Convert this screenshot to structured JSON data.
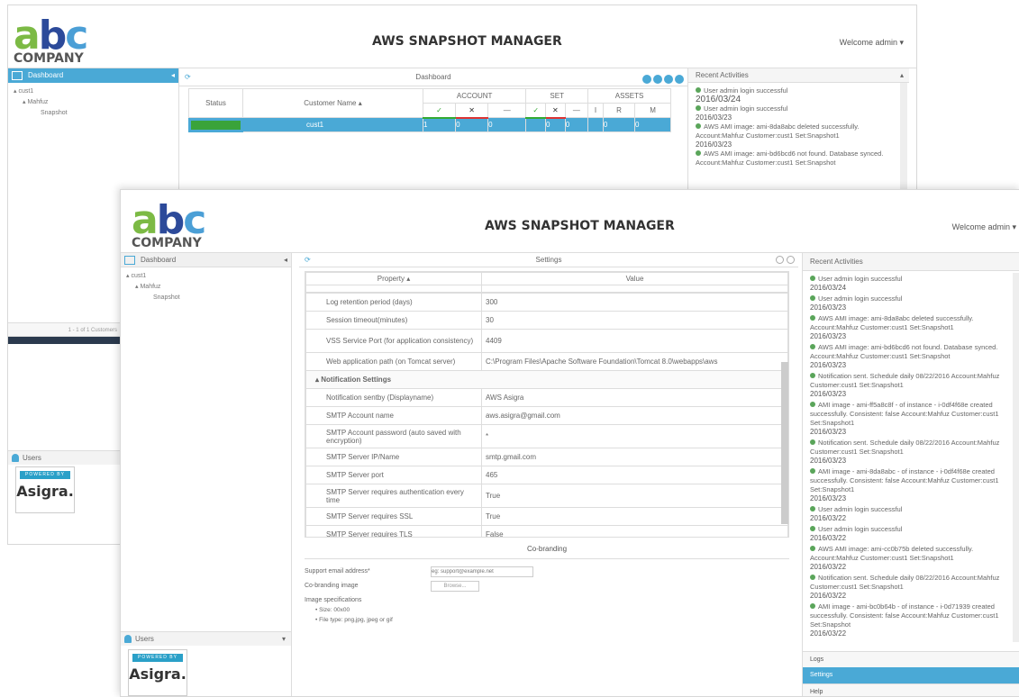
{
  "back": {
    "logo": {
      "a": "a",
      "b": "b",
      "c": "c",
      "company": "COMPANY"
    },
    "title": "AWS SNAPSHOT MANAGER",
    "welcome": "Welcome admin ▾",
    "tree_header": "Dashboard",
    "tree": [
      "cust1",
      "Mahfuz",
      "Snapshot"
    ],
    "center_title": "Dashboard",
    "table": {
      "status_col": "Status",
      "customer_col": "Customer Name ▴",
      "groups": [
        "ACCOUNT",
        "SET",
        "ASSETS"
      ],
      "sub": [
        "✓",
        "✕",
        "—",
        "✓",
        "✕",
        "—",
        "I",
        "R",
        "M"
      ],
      "row": {
        "customer": "cust1",
        "cells": [
          "1",
          "0",
          "0",
          "",
          "0",
          "0",
          "",
          "0",
          "0"
        ]
      }
    },
    "pager": "1 - 1 of 1 Customers",
    "recent_header": "Recent Activities",
    "activities": [
      {
        "text": "User admin login successful",
        "date": "2016/03/24"
      },
      {
        "text": "User admin login successful",
        "date": "2016/03/23"
      },
      {
        "text": "AWS AMI image: ami-8da8abc deleted successfully. Account:Mahfuz Customer:cust1 Set:Snapshot1",
        "date": "2016/03/23"
      },
      {
        "text": "AWS AMI image: ami-bd6bcd6 not found. Database synced. Account:Mahfuz Customer:cust1 Set:Snapshot",
        "date": ""
      }
    ],
    "users": "Users",
    "asigra": {
      "powered": "POWERED BY",
      "name": "Asigra."
    }
  },
  "front": {
    "logo": {
      "a": "a",
      "b": "b",
      "c": "c",
      "company": "COMPANY"
    },
    "title": "AWS SNAPSHOT MANAGER",
    "welcome": "Welcome admin ▾",
    "tree_header": "Dashboard",
    "tree": [
      "cust1",
      "Mahfuz",
      "Snapshot"
    ],
    "center_title": "Settings",
    "cols": {
      "property": "Property ▴",
      "value": "Value"
    },
    "rows": [
      {
        "p": "Log retention period (days)",
        "v": "300"
      },
      {
        "p": "Session timeout(minutes)",
        "v": "30"
      },
      {
        "p": "VSS Service Port (for application consistency)",
        "v": "4409"
      },
      {
        "p": "Web application path (on Tomcat server)",
        "v": "C:\\Program Files\\Apache Software Foundation\\Tomcat 8.0\\webapps\\aws"
      },
      {
        "p": "Notification Settings",
        "v": "",
        "group": true
      },
      {
        "p": "Notification sentby (Displayname)",
        "v": "AWS Asigra"
      },
      {
        "p": "SMTP Account name",
        "v": "aws.asigra@gmail.com"
      },
      {
        "p": "SMTP Account password (auto saved with encryption)",
        "v": "*"
      },
      {
        "p": "SMTP Server IP/Name",
        "v": "smtp.gmail.com"
      },
      {
        "p": "SMTP Server port",
        "v": "465"
      },
      {
        "p": "SMTP Server requires authentication every time",
        "v": "True"
      },
      {
        "p": "SMTP Server requires SSL",
        "v": "True"
      },
      {
        "p": "SMTP Server requires TLS",
        "v": "False"
      }
    ],
    "cobranding": {
      "header": "Co-branding",
      "email_label": "Support email address*",
      "email_placeholder": "eg: support@example.net",
      "image_label": "Co-branding image",
      "browse": "Browse...",
      "spec_label": "Image specifications",
      "specs": [
        "Size: 00x00",
        "File type: png,jpg, jpeg or gif"
      ]
    },
    "recent_header": "Recent Activities",
    "activities": [
      {
        "text": "User admin login successful",
        "date": "2016/03/24"
      },
      {
        "text": "User admin login successful",
        "date": "2016/03/23"
      },
      {
        "text": "AWS AMI image: ami-8da8abc deleted successfully. Account:Mahfuz Customer:cust1 Set:Snapshot1",
        "date": "2016/03/23"
      },
      {
        "text": "AWS AMI image: ami-bd6bcd6 not found. Database synced. Account:Mahfuz Customer:cust1 Set:Snapshot",
        "date": "2016/03/23"
      },
      {
        "text": "Notification sent. Schedule daily 08/22/2016 Account:Mahfuz Customer:cust1 Set:Snapshot1",
        "date": "2016/03/23"
      },
      {
        "text": "AMI image - ami-ff5a8c8f - of instance - i-0df4f68e created successfully. Consistent: false Account:Mahfuz Customer:cust1 Set:Snapshot1",
        "date": "2016/03/23"
      },
      {
        "text": "Notification sent. Schedule daily 08/22/2016 Account:Mahfuz Customer:cust1 Set:Snapshot1",
        "date": "2016/03/23"
      },
      {
        "text": "AMI image - ami-8da8abc - of instance - i-0df4f68e created successfully. Consistent: false Account:Mahfuz Customer:cust1 Set:Snapshot1",
        "date": "2016/03/23"
      },
      {
        "text": "User admin login successful",
        "date": "2016/03/22"
      },
      {
        "text": "User admin login successful",
        "date": "2016/03/22"
      },
      {
        "text": "AWS AMI image: ami-cc0b75b deleted successfully. Account:Mahfuz Customer:cust1 Set:Snapshot1",
        "date": "2016/03/22"
      },
      {
        "text": "Notification sent. Schedule daily 08/22/2016 Account:Mahfuz Customer:cust1 Set:Snapshot1",
        "date": "2016/03/22"
      },
      {
        "text": "AMI image - ami-bc0b64b - of instance - i-0d71939 created successfully. Consistent: false Account:Mahfuz Customer:cust1 Set:Snapshot",
        "date": "2016/03/22"
      }
    ],
    "bottom_tabs": [
      "Logs",
      "Settings",
      "Help"
    ],
    "users": "Users",
    "asigra": {
      "powered": "POWERED BY",
      "name": "Asigra."
    }
  }
}
